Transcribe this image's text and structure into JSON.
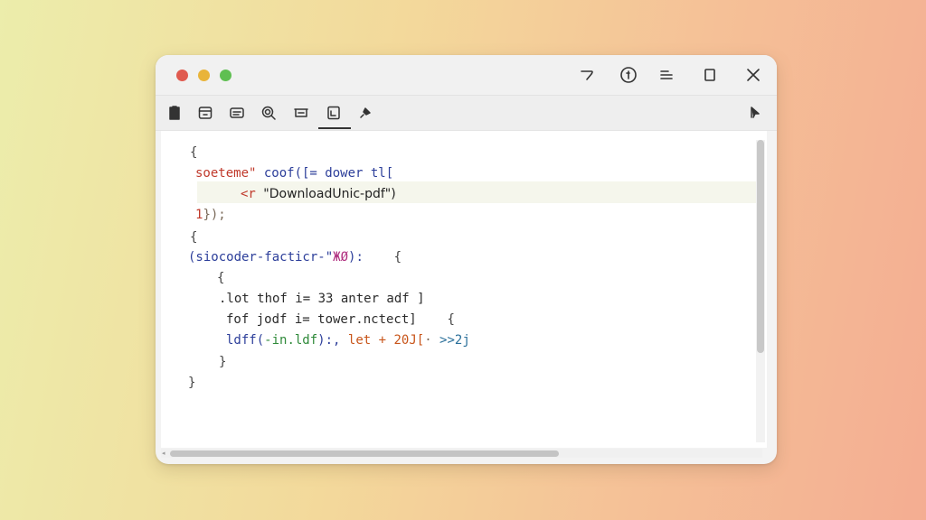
{
  "window": {
    "controls": [
      {
        "icon": "minimize-curve-icon"
      },
      {
        "icon": "info-circle-icon"
      },
      {
        "icon": "menu-lines-icon"
      },
      {
        "icon": "maximize-square-icon"
      },
      {
        "icon": "close-icon"
      }
    ]
  },
  "toolbar": {
    "tools": [
      {
        "icon": "clipboard-icon"
      },
      {
        "icon": "window-icon"
      },
      {
        "icon": "text-box-icon"
      },
      {
        "icon": "search-zoom-icon"
      },
      {
        "icon": "tray-icon"
      },
      {
        "icon": "document-icon",
        "active": true
      },
      {
        "icon": "pin-icon"
      }
    ],
    "right_tool": {
      "icon": "pointer-cursor-icon"
    }
  },
  "editor": {
    "lines": [
      {
        "parts": [
          {
            "t": "{",
            "c": "c-brace"
          }
        ]
      },
      {
        "parts": [
          {
            "t": "soeteme\" ",
            "c": "c-kw"
          },
          {
            "t": "coof([= dower tl[",
            "c": "c-fn"
          }
        ]
      },
      {
        "parts": [
          {
            "t": "<r ",
            "c": "c-kw"
          },
          {
            "t": "\"DownloadUnic-pdf\")",
            "c": "c-str"
          }
        ]
      },
      {
        "parts": [
          {
            "t": "1",
            "c": "c-kw"
          },
          {
            "t": "});",
            "c": "c-dim"
          }
        ]
      },
      {
        "parts": [
          {
            "t": "{",
            "c": "c-brace"
          }
        ]
      },
      {
        "parts": [
          {
            "t": "(siocoder-facticr-\"",
            "c": "c-fn"
          },
          {
            "t": "ЖØ",
            "c": "c-magenta"
          },
          {
            "t": "):    ",
            "c": "c-fn"
          },
          {
            "t": "{",
            "c": "c-brace"
          }
        ]
      },
      {
        "parts": [
          {
            "t": "{",
            "c": "c-brace"
          }
        ]
      },
      {
        "parts": [
          {
            "t": ".lot thof i= 33 anter adf ]",
            "c": "c-dark"
          }
        ]
      },
      {
        "parts": [
          {
            "t": "fof jodf i= tower.nctect]    ",
            "c": "c-dark"
          },
          {
            "t": "{",
            "c": "c-brace"
          }
        ]
      },
      {
        "parts": [
          {
            "t": "ldff(",
            "c": "c-fn"
          },
          {
            "t": "-in.ldf",
            "c": "c-green"
          },
          {
            "t": "):, ",
            "c": "c-fn"
          },
          {
            "t": "let + 20J[",
            "c": "c-orange"
          },
          {
            "t": "· ",
            "c": "c-dim"
          },
          {
            "t": ">>2j",
            "c": "c-teal"
          }
        ]
      },
      {
        "parts": [
          {
            "t": "}",
            "c": "c-brace"
          }
        ]
      },
      {
        "parts": [
          {
            "t": "}",
            "c": "c-brace"
          }
        ]
      }
    ]
  },
  "colors": {
    "editor_bg": "#ffffff",
    "highlight_line": "#f5f6ec",
    "close_dot": "#e05a4f",
    "minimize_dot": "#e9b43a",
    "zoom_dot": "#5fbf52"
  }
}
